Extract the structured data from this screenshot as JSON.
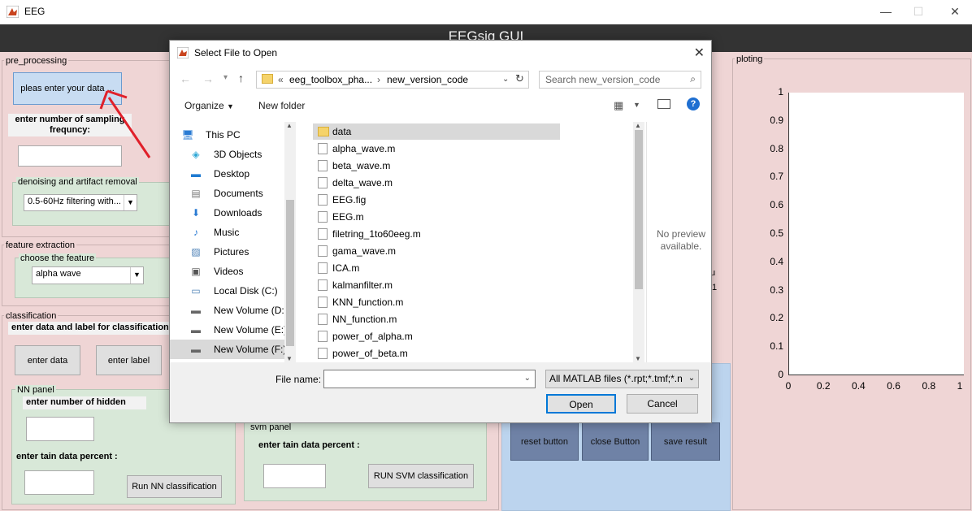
{
  "app": {
    "title": "EEG",
    "header": "EEGsig GUI"
  },
  "preprocessing": {
    "title": "pre_processing",
    "enter_data_button": "pleas enter your data ...",
    "sampling_label": "enter number of sampling frequncy:",
    "denoise_title": "denoising and artifact removal",
    "denoise_select": "0.5-60Hz filtering with..."
  },
  "feature": {
    "title": "feature extraction",
    "choose_title": "choose the feature",
    "select_value": "alpha wave"
  },
  "classification": {
    "title": "classification",
    "label": "enter data and label for classification",
    "enter_data_button": "enter data",
    "enter_label_button": "enter label",
    "nn_title": "NN panel",
    "nn_hidden_label": "enter number of hidden",
    "nn_train_label": "enter tain data percent :",
    "nn_run_button": "Run NN classification",
    "svm_title": "svm panel",
    "svm_train_label": "enter tain data percent :",
    "svm_run_button": "RUN SVM classification"
  },
  "bottom_buttons": {
    "reset": "reset button",
    "close": "close Button",
    "save": "save result"
  },
  "plot": {
    "title": "ploting",
    "yticks": [
      "1",
      "0.9",
      "0.8",
      "0.7",
      "0.6",
      "0.5",
      "0.4",
      "0.3",
      "0.2",
      "0.1",
      "0"
    ],
    "xticks": [
      "0",
      "0.2",
      "0.4",
      "0.6",
      "0.8",
      "1"
    ],
    "ylim": [
      0,
      1
    ],
    "xlim": [
      0,
      1
    ]
  },
  "partial_text": {
    "u": "u",
    "one": "1"
  },
  "dialog": {
    "title": "Select File to Open",
    "breadcrumb_prefix": "«",
    "breadcrumb_1": "eeg_toolbox_pha...",
    "breadcrumb_sep": "›",
    "breadcrumb_2": "new_version_code",
    "search_placeholder": "Search new_version_code",
    "organize": "Organize",
    "new_folder": "New folder",
    "nav_items": [
      {
        "label": "This PC",
        "icon": "pc-icon"
      },
      {
        "label": "3D Objects",
        "icon": "3d-objects-icon"
      },
      {
        "label": "Desktop",
        "icon": "desktop-icon"
      },
      {
        "label": "Documents",
        "icon": "documents-icon"
      },
      {
        "label": "Downloads",
        "icon": "downloads-icon"
      },
      {
        "label": "Music",
        "icon": "music-icon"
      },
      {
        "label": "Pictures",
        "icon": "pictures-icon"
      },
      {
        "label": "Videos",
        "icon": "videos-icon"
      },
      {
        "label": "Local Disk (C:)",
        "icon": "disk-icon"
      },
      {
        "label": "New Volume (D:",
        "icon": "drive-icon"
      },
      {
        "label": "New Volume (E:)",
        "icon": "drive-icon"
      },
      {
        "label": "New Volume (F:)",
        "icon": "drive-icon"
      }
    ],
    "files": [
      {
        "name": "data",
        "type": "folder"
      },
      {
        "name": "alpha_wave.m",
        "type": "file"
      },
      {
        "name": "beta_wave.m",
        "type": "file"
      },
      {
        "name": "delta_wave.m",
        "type": "file"
      },
      {
        "name": "EEG.fig",
        "type": "file"
      },
      {
        "name": "EEG.m",
        "type": "file"
      },
      {
        "name": "filetring_1to60eeg.m",
        "type": "file"
      },
      {
        "name": "gama_wave.m",
        "type": "file"
      },
      {
        "name": "ICA.m",
        "type": "file"
      },
      {
        "name": "kalmanfilter.m",
        "type": "file"
      },
      {
        "name": "KNN_function.m",
        "type": "file"
      },
      {
        "name": "NN_function.m",
        "type": "file"
      },
      {
        "name": "power_of_alpha.m",
        "type": "file"
      },
      {
        "name": "power_of_beta.m",
        "type": "file"
      }
    ],
    "preview_text": "No preview available.",
    "filename_label": "File name:",
    "filename_value": "",
    "filetype_value": "All MATLAB files (*.rpt;*.tmf;*.n",
    "open_button": "Open",
    "cancel_button": "Cancel"
  },
  "colors": {
    "body_bg": "#efd5d5",
    "header_bg": "#333333",
    "annotation_arrow": "#e0202a"
  }
}
